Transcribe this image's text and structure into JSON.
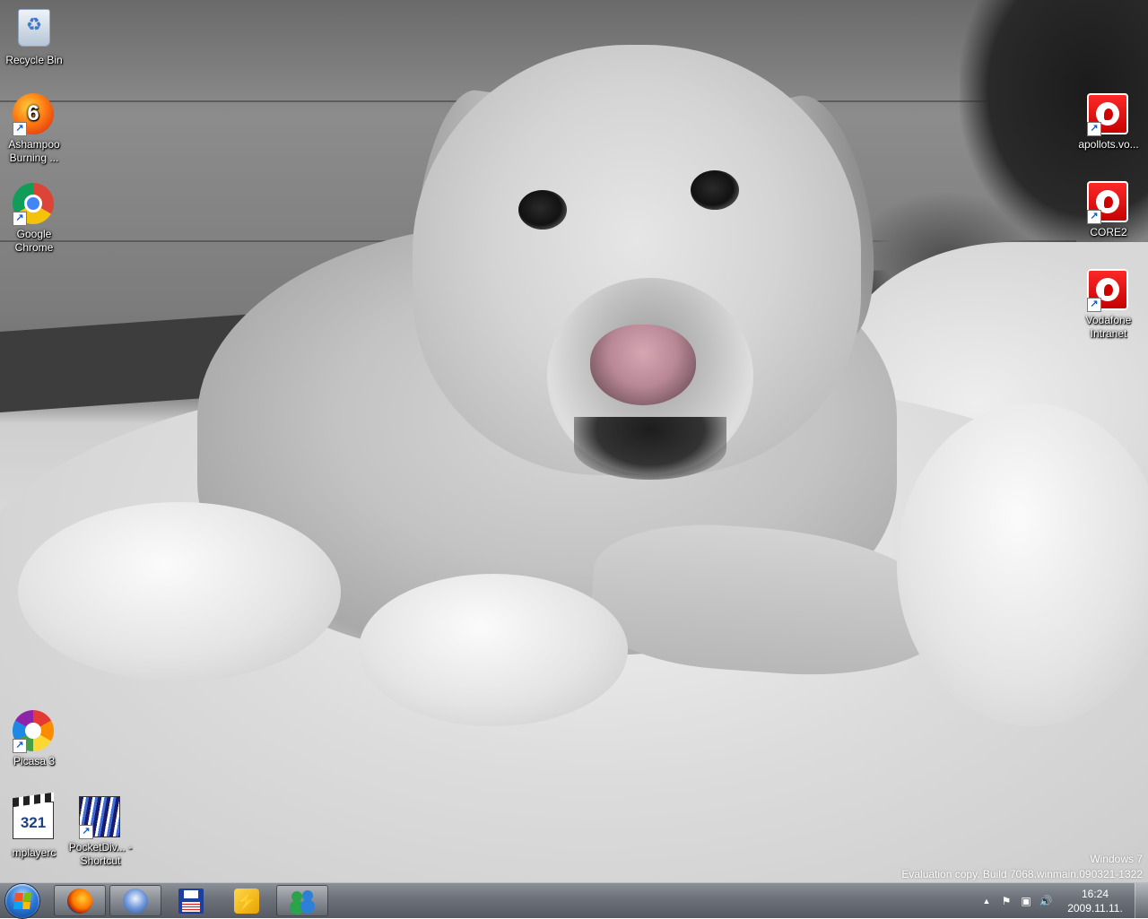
{
  "desktop": {
    "wallpaper": "snow-dog-photo",
    "icons_left": [
      {
        "label": "Recycle Bin",
        "icon": "recycle-bin-icon"
      },
      {
        "label": "Ashampoo Burning ...",
        "icon": "ashampoo-burning-icon"
      },
      {
        "label": "Google Chrome",
        "icon": "chrome-icon"
      },
      {
        "label": "Picasa 3",
        "icon": "picasa-icon"
      },
      {
        "label": "mplayerc",
        "icon": "mplayerc-icon"
      },
      {
        "label": "PocketDiv... - Shortcut",
        "icon": "pocketdivx-icon"
      }
    ],
    "icons_right": [
      {
        "label": "apollots.vo...",
        "icon": "vodafone-icon"
      },
      {
        "label": "CORE2",
        "icon": "vodafone-icon"
      },
      {
        "label": "Vodafone Intranet",
        "icon": "vodafone-icon"
      }
    ],
    "ashampoo_badge": "6",
    "mplayer_badge": "321",
    "watermark": {
      "line1": "Windows 7",
      "line2": "Evaluation copy. Build 7068.winmain.090321-1322"
    }
  },
  "taskbar": {
    "pinned": [
      {
        "name": "firefox",
        "icon": "firefox-icon"
      },
      {
        "name": "thunderbird",
        "icon": "thunderbird-icon"
      },
      {
        "name": "save-tool",
        "icon": "floppy-disk-icon"
      },
      {
        "name": "winamp",
        "icon": "winamp-icon"
      },
      {
        "name": "messenger",
        "icon": "messenger-icon"
      }
    ],
    "tray": {
      "arrow": "▲",
      "flag": "⚑",
      "network": "▣",
      "volume": "🔊"
    },
    "clock": {
      "time": "16:24",
      "date": "2009.11.11."
    }
  },
  "colors": {
    "taskbar": "#6b7079",
    "vodafone_red": "#e60000",
    "text": "#ffffff"
  }
}
